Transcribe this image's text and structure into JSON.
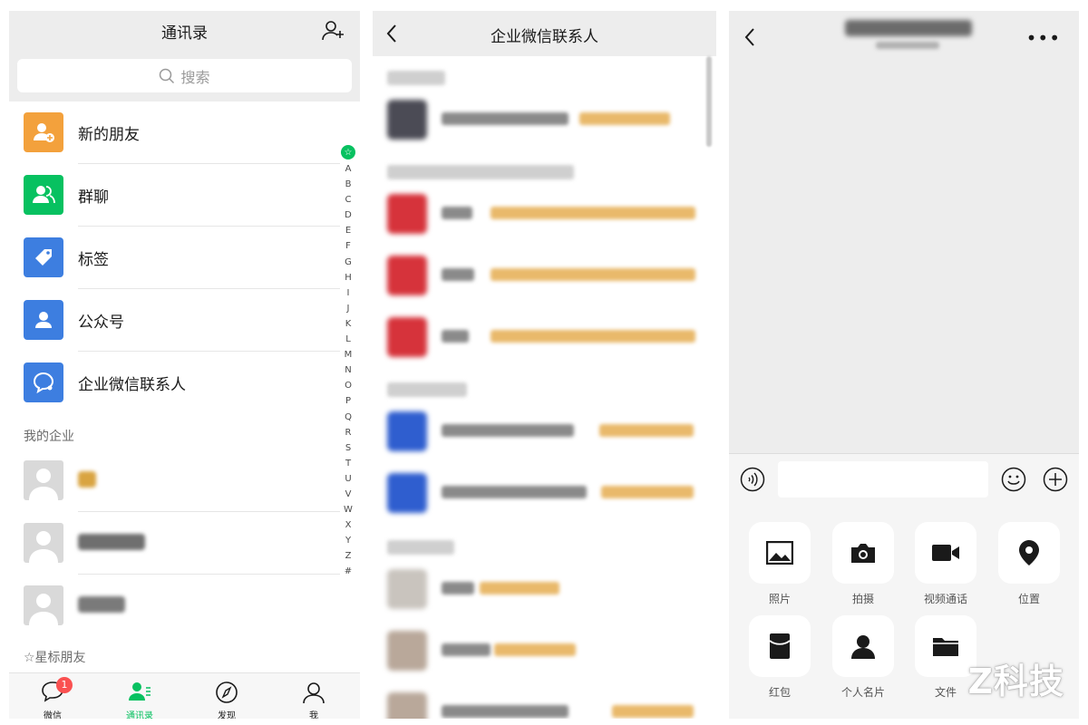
{
  "contacts_screen": {
    "title": "通讯录",
    "search_placeholder": "搜索",
    "menu_items": [
      {
        "label": "新的朋友",
        "icon": "new-friends-icon",
        "color": "#f3a13c"
      },
      {
        "label": "群聊",
        "icon": "group-chat-icon",
        "color": "#07c160"
      },
      {
        "label": "标签",
        "icon": "tag-icon",
        "color": "#3d7ee0"
      },
      {
        "label": "公众号",
        "icon": "official-account-icon",
        "color": "#3d7ee0"
      },
      {
        "label": "企业微信联系人",
        "icon": "work-contacts-icon",
        "color": "#3d7ee0"
      }
    ],
    "my_company_label": "我的企业",
    "starred_label": "☆星标朋友",
    "index_letters": [
      "A",
      "B",
      "C",
      "D",
      "E",
      "F",
      "G",
      "H",
      "I",
      "J",
      "K",
      "L",
      "M",
      "N",
      "O",
      "P",
      "Q",
      "R",
      "S",
      "T",
      "U",
      "V",
      "W",
      "X",
      "Y",
      "Z",
      "#"
    ],
    "tabs": [
      {
        "label": "微信",
        "icon": "chat-icon",
        "badge": "1"
      },
      {
        "label": "通讯录",
        "icon": "contacts-icon",
        "active": true
      },
      {
        "label": "发现",
        "icon": "compass-icon"
      },
      {
        "label": "我",
        "icon": "profile-icon"
      }
    ],
    "accent_color": "#07c160"
  },
  "work_contacts_screen": {
    "title": "企业微信联系人"
  },
  "chat_screen": {
    "tools": [
      {
        "label": "照片",
        "icon": "photo-icon"
      },
      {
        "label": "拍摄",
        "icon": "camera-icon"
      },
      {
        "label": "视频通话",
        "icon": "video-call-icon"
      },
      {
        "label": "位置",
        "icon": "location-icon"
      },
      {
        "label": "红包",
        "icon": "red-packet-icon"
      },
      {
        "label": "个人名片",
        "icon": "contact-card-icon"
      },
      {
        "label": "文件",
        "icon": "file-icon"
      }
    ]
  },
  "watermark": "Z科技"
}
